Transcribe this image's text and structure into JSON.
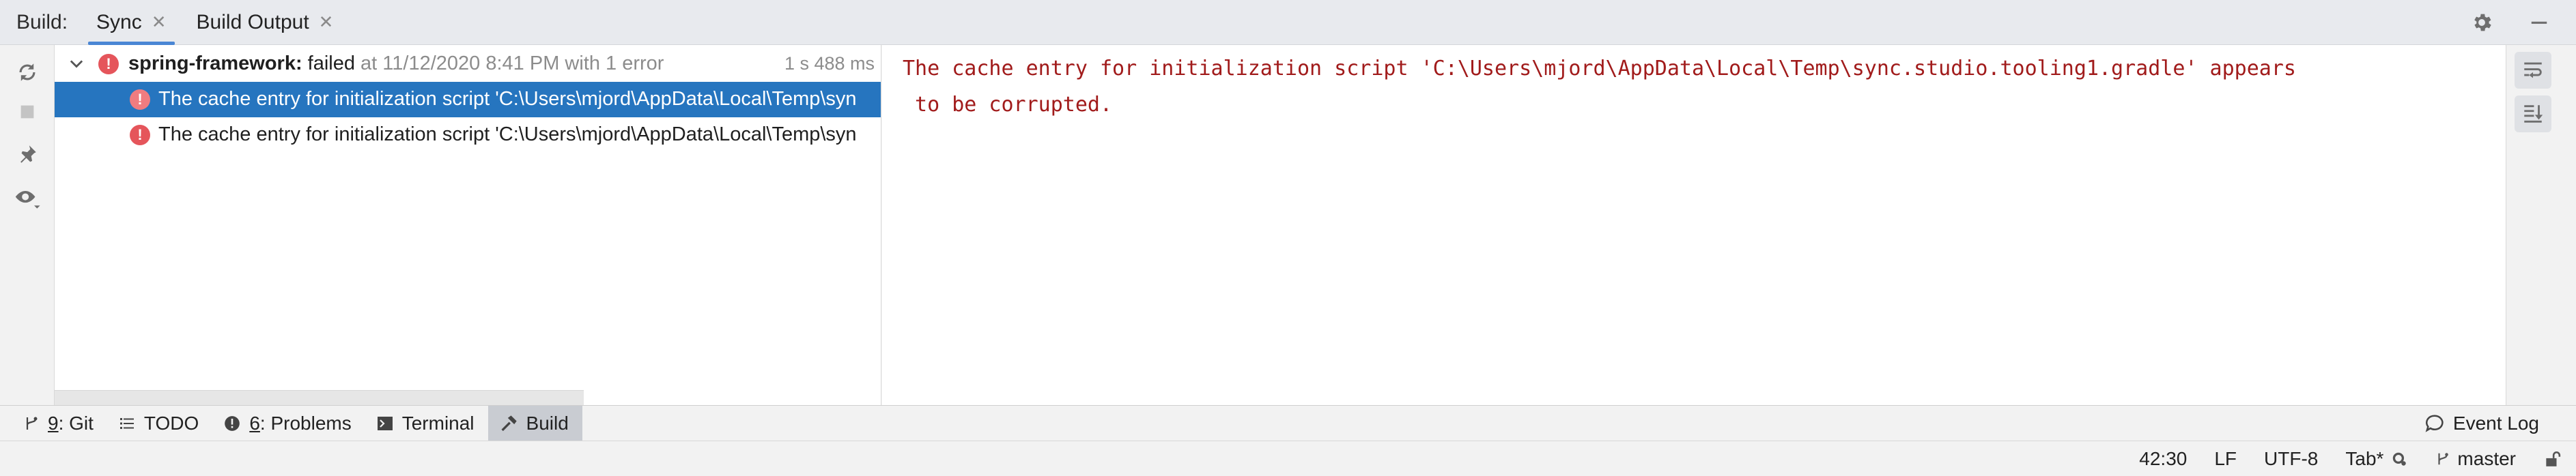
{
  "header": {
    "build_label": "Build:",
    "tabs": [
      {
        "label": "Sync",
        "close": "✕"
      },
      {
        "label": "Build Output",
        "close": "✕"
      }
    ]
  },
  "tree": {
    "root": {
      "name": "spring-framework:",
      "status": " failed",
      "meta": " at 11/12/2020 8:41 PM with 1 error",
      "time": "1 s 488 ms"
    },
    "children": [
      {
        "message": "The cache entry for initialization script 'C:\\Users\\mjord\\AppData\\Local\\Temp\\syn"
      },
      {
        "message": "The cache entry for initialization script 'C:\\Users\\mjord\\AppData\\Local\\Temp\\syn"
      }
    ]
  },
  "console": {
    "lines": [
      "The cache entry for initialization script 'C:\\Users\\mjord\\AppData\\Local\\Temp\\sync.studio.tooling1.gradle' appears",
      " to be corrupted."
    ]
  },
  "tool_windows": [
    {
      "mnemonic": "9",
      "label": ": Git"
    },
    {
      "mnemonic": "",
      "label": "TODO"
    },
    {
      "mnemonic": "6",
      "label": ": Problems"
    },
    {
      "mnemonic": "",
      "label": "Terminal"
    },
    {
      "mnemonic": "",
      "label": "Build"
    }
  ],
  "event_log": "Event Log",
  "status_bar": {
    "position": "42:30",
    "line_separator": "LF",
    "encoding": "UTF-8",
    "indent": "Tab*",
    "branch": "master"
  },
  "colors": {
    "selection": "#2675bf",
    "error": "#e5555b",
    "console_text": "#a11b1b",
    "tab_underline": "#4a86d4"
  },
  "icons": [
    "gear-icon",
    "minimize-icon",
    "sync-icon",
    "stop-icon",
    "pin-icon",
    "eye-icon",
    "chevron-down-icon",
    "error-icon",
    "soft-wrap-icon",
    "scroll-to-end-icon",
    "git-icon",
    "todo-icon",
    "problems-icon",
    "terminal-icon",
    "build-hammer-icon",
    "event-log-icon",
    "lock-icon"
  ]
}
